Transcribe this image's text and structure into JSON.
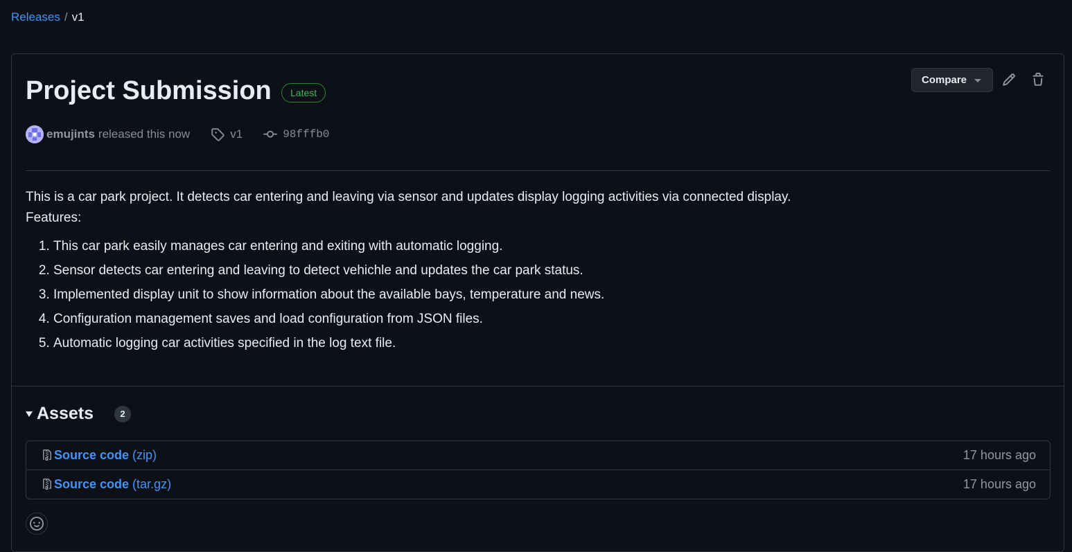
{
  "breadcrumb": {
    "releases_label": "Releases",
    "separator": "/",
    "current": "v1"
  },
  "release": {
    "title": "Project Submission",
    "latest_badge": "Latest",
    "compare_label": "Compare",
    "author": "emujints",
    "released_text": "released this now",
    "tag": "v1",
    "commit": "98fffb0",
    "description_line1": "This is a car park project. It detects car entering and leaving via sensor and updates display logging activities via connected display.",
    "description_line2": "Features:",
    "features": [
      "This car park easily manages car entering and exiting with automatic logging.",
      "Sensor detects car entering and leaving to detect vehichle and updates the car park status.",
      "Implemented display unit to show information about the available bays, temperature and news.",
      "Configuration management saves and load configuration from JSON files.",
      "Automatic logging car activities specified in the log text file."
    ]
  },
  "assets": {
    "label": "Assets",
    "count": "2",
    "items": [
      {
        "name": "Source code",
        "ext": "(zip)",
        "time": "17 hours ago"
      },
      {
        "name": "Source code",
        "ext": "(tar.gz)",
        "time": "17 hours ago"
      }
    ]
  },
  "colors": {
    "background": "#0d1117",
    "link": "#4493f8",
    "latest_green": "#3fb950",
    "border": "#30363d"
  },
  "icons": [
    "pencil-icon",
    "trash-icon",
    "tag-icon",
    "commit-icon",
    "file-zip-icon",
    "smiley-icon"
  ]
}
